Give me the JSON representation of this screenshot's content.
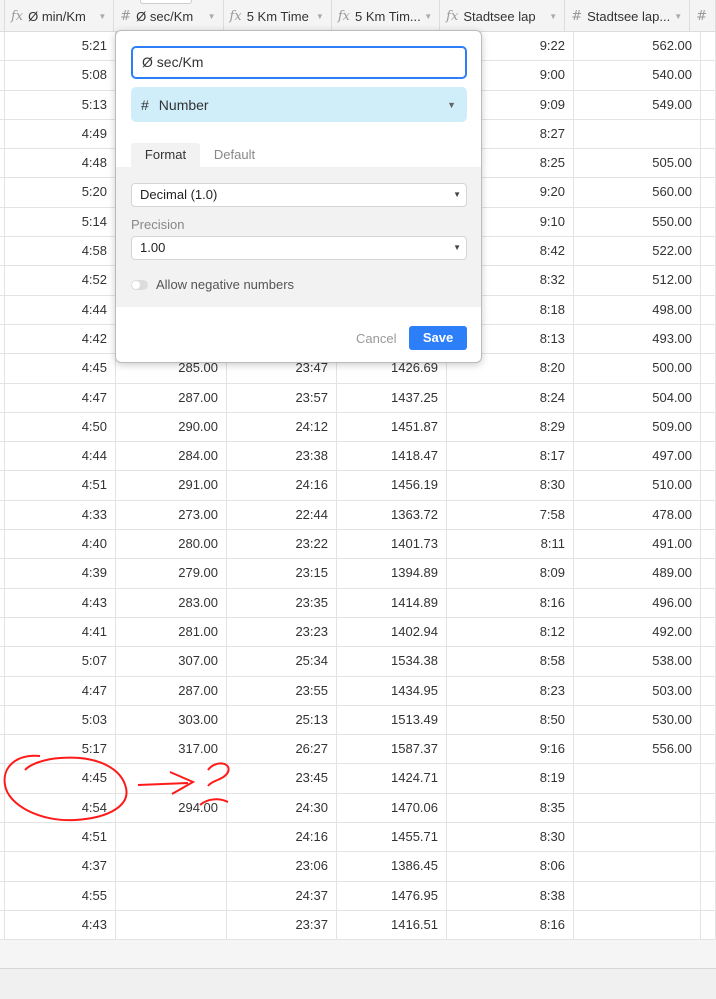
{
  "columns": [
    {
      "icon": "formula-icon",
      "label": "Ø min/Km"
    },
    {
      "icon": "hash-icon",
      "label": "Ø sec/Km"
    },
    {
      "icon": "formula-icon",
      "label": "5 Km Time"
    },
    {
      "icon": "formula-icon",
      "label": "5 Km Tim..."
    },
    {
      "icon": "formula-icon",
      "label": "Stadtsee lap"
    },
    {
      "icon": "hash-icon",
      "label": "Stadtsee lap..."
    },
    {
      "icon": "hash-icon",
      "label": ""
    }
  ],
  "rows": [
    [
      "5:21",
      "",
      "",
      "",
      "9:22",
      "562.00"
    ],
    [
      "5:08",
      "",
      "",
      "",
      "9:00",
      "540.00"
    ],
    [
      "5:13",
      "",
      "",
      "",
      "9:09",
      "549.00"
    ],
    [
      "4:49",
      "",
      "",
      "",
      "8:27",
      ""
    ],
    [
      "4:48",
      "",
      "",
      "",
      "8:25",
      "505.00"
    ],
    [
      "5:20",
      "",
      "",
      "",
      "9:20",
      "560.00"
    ],
    [
      "5:14",
      "",
      "",
      "",
      "9:10",
      "550.00"
    ],
    [
      "4:58",
      "",
      "",
      "",
      "8:42",
      "522.00"
    ],
    [
      "4:52",
      "",
      "",
      "",
      "8:32",
      "512.00"
    ],
    [
      "4:44",
      "",
      "",
      "",
      "8:18",
      "498.00"
    ],
    [
      "4:42",
      "",
      "",
      "",
      "8:13",
      "493.00"
    ],
    [
      "4:45",
      "285.00",
      "23:47",
      "1426.69",
      "8:20",
      "500.00"
    ],
    [
      "4:47",
      "287.00",
      "23:57",
      "1437.25",
      "8:24",
      "504.00"
    ],
    [
      "4:50",
      "290.00",
      "24:12",
      "1451.87",
      "8:29",
      "509.00"
    ],
    [
      "4:44",
      "284.00",
      "23:38",
      "1418.47",
      "8:17",
      "497.00"
    ],
    [
      "4:51",
      "291.00",
      "24:16",
      "1456.19",
      "8:30",
      "510.00"
    ],
    [
      "4:33",
      "273.00",
      "22:44",
      "1363.72",
      "7:58",
      "478.00"
    ],
    [
      "4:40",
      "280.00",
      "23:22",
      "1401.73",
      "8:11",
      "491.00"
    ],
    [
      "4:39",
      "279.00",
      "23:15",
      "1394.89",
      "8:09",
      "489.00"
    ],
    [
      "4:43",
      "283.00",
      "23:35",
      "1414.89",
      "8:16",
      "496.00"
    ],
    [
      "4:41",
      "281.00",
      "23:23",
      "1402.94",
      "8:12",
      "492.00"
    ],
    [
      "5:07",
      "307.00",
      "25:34",
      "1534.38",
      "8:58",
      "538.00"
    ],
    [
      "4:47",
      "287.00",
      "23:55",
      "1434.95",
      "8:23",
      "503.00"
    ],
    [
      "5:03",
      "303.00",
      "25:13",
      "1513.49",
      "8:50",
      "530.00"
    ],
    [
      "5:17",
      "317.00",
      "26:27",
      "1587.37",
      "9:16",
      "556.00"
    ],
    [
      "4:45",
      "",
      "23:45",
      "1424.71",
      "8:19",
      ""
    ],
    [
      "4:54",
      "294.00",
      "24:30",
      "1470.06",
      "8:35",
      ""
    ],
    [
      "4:51",
      "",
      "24:16",
      "1455.71",
      "8:30",
      ""
    ],
    [
      "4:37",
      "",
      "23:06",
      "1386.45",
      "8:06",
      ""
    ],
    [
      "4:55",
      "",
      "24:37",
      "1476.95",
      "8:38",
      ""
    ],
    [
      "4:43",
      "",
      "23:37",
      "1416.51",
      "8:16",
      ""
    ]
  ],
  "popup": {
    "field_name": "Ø sec/Km",
    "field_type": "Number",
    "tabs": [
      "Format",
      "Default"
    ],
    "active_tab": "Format",
    "format": "Decimal (1.0)",
    "precision_label": "Precision",
    "precision": "1.00",
    "allow_negative_label": "Allow negative numbers",
    "allow_negative": false,
    "cancel_label": "Cancel",
    "save_label": "Save",
    "accent_color": "#2d7ff9",
    "type_bg_color": "#cfeefa"
  },
  "annotation_color": "#ff1a1a"
}
